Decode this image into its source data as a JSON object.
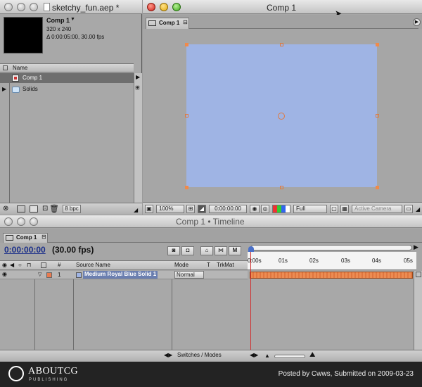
{
  "project": {
    "window_title": "sketchy_fun.aep *",
    "selected_name": "Comp 1",
    "selected_size": "320 x 240",
    "selected_info": "Δ 0:00:05:00, 30.00 fps",
    "column_name": "Name",
    "items": [
      {
        "label": "Comp 1",
        "icon": "comp-icon"
      },
      {
        "label": "Solids",
        "icon": "folder-icon"
      }
    ],
    "bpc_label": "8 bpc"
  },
  "comp_viewer": {
    "window_title": "Comp 1",
    "tab_label": "Comp 1",
    "solid_color": "#9fb4e4",
    "zoom": "100%",
    "timecode": "0:00:00:00",
    "resolution": "Full",
    "camera": "Active Camera"
  },
  "timeline": {
    "window_title": "Comp 1 • Timeline",
    "tab_label": "Comp 1",
    "timecode": "0:00:00:00",
    "fps": "(30.00 fps)",
    "columns": {
      "number": "#",
      "source_name": "Source Name",
      "mode": "Mode",
      "t": "T",
      "trkmat": "TrkMat"
    },
    "ruler": [
      "0:00s",
      "01s",
      "02s",
      "03s",
      "04s",
      "05s"
    ],
    "layer": {
      "number": "1",
      "name": "Medium Royal Blue Solid 1",
      "mode": "Normal"
    },
    "switches_label": "Switches / Modes"
  },
  "footer": {
    "logo": "ABOUTCG",
    "logo_sub": "PUBLISHING",
    "credit": "Posted by Cwws, Submitted on 2009-03-23"
  }
}
